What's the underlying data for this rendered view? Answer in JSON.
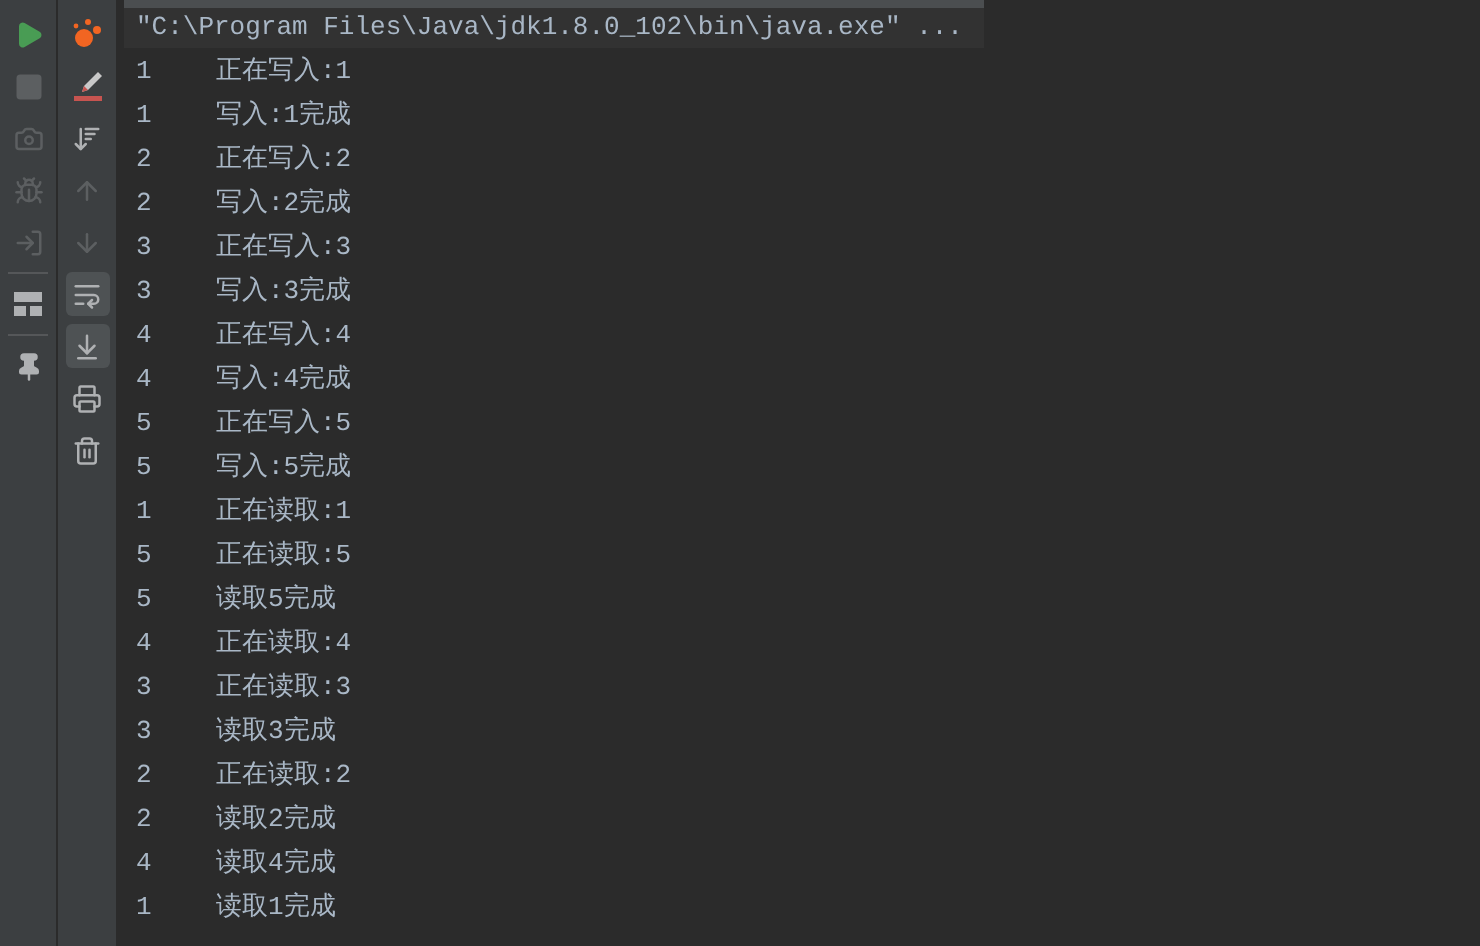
{
  "left_toolbar": {
    "groups": [
      {
        "buttons": [
          {
            "kind": "run",
            "disabled": false
          },
          {
            "kind": "stop",
            "disabled": true
          },
          {
            "kind": "camera",
            "disabled": true
          },
          {
            "kind": "debug",
            "disabled": true
          },
          {
            "kind": "exit",
            "disabled": true
          }
        ]
      },
      {
        "buttons": [
          {
            "kind": "layout",
            "disabled": false
          }
        ]
      },
      {
        "buttons": [
          {
            "kind": "pin",
            "disabled": false
          }
        ]
      }
    ]
  },
  "console_toolbar": {
    "buttons": [
      {
        "kind": "analyze",
        "disabled": false,
        "on": false
      },
      {
        "kind": "clear",
        "disabled": false,
        "on": false
      },
      {
        "kind": "sort",
        "disabled": false,
        "on": false
      },
      {
        "kind": "up",
        "disabled": true,
        "on": false
      },
      {
        "kind": "down",
        "disabled": true,
        "on": false
      },
      {
        "kind": "wrap",
        "disabled": false,
        "on": true
      },
      {
        "kind": "scroll-end",
        "disabled": false,
        "on": true
      },
      {
        "kind": "print",
        "disabled": false,
        "on": false
      },
      {
        "kind": "trash",
        "disabled": false,
        "on": false
      }
    ]
  },
  "console": {
    "command": "\"C:\\Program Files\\Java\\jdk1.8.0_102\\bin\\java.exe\" ...",
    "lines": [
      {
        "number": "1",
        "message": "正在写入:1"
      },
      {
        "number": "1",
        "message": "写入:1完成"
      },
      {
        "number": "2",
        "message": "正在写入:2"
      },
      {
        "number": "2",
        "message": "写入:2完成"
      },
      {
        "number": "3",
        "message": "正在写入:3"
      },
      {
        "number": "3",
        "message": "写入:3完成"
      },
      {
        "number": "4",
        "message": "正在写入:4"
      },
      {
        "number": "4",
        "message": "写入:4完成"
      },
      {
        "number": "5",
        "message": "正在写入:5"
      },
      {
        "number": "5",
        "message": "写入:5完成"
      },
      {
        "number": "1",
        "message": "正在读取:1"
      },
      {
        "number": "5",
        "message": "正在读取:5"
      },
      {
        "number": "5",
        "message": "读取5完成"
      },
      {
        "number": "4",
        "message": "正在读取:4"
      },
      {
        "number": "3",
        "message": "正在读取:3"
      },
      {
        "number": "3",
        "message": "读取3完成"
      },
      {
        "number": "2",
        "message": "正在读取:2"
      },
      {
        "number": "2",
        "message": "读取2完成"
      },
      {
        "number": "4",
        "message": "读取4完成"
      },
      {
        "number": "1",
        "message": "读取1完成"
      }
    ]
  }
}
